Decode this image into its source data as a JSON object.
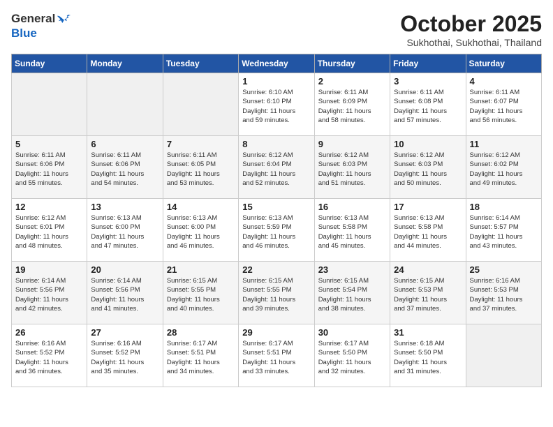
{
  "header": {
    "logo_general": "General",
    "logo_blue": "Blue",
    "month": "October 2025",
    "location": "Sukhothai, Sukhothai, Thailand"
  },
  "weekdays": [
    "Sunday",
    "Monday",
    "Tuesday",
    "Wednesday",
    "Thursday",
    "Friday",
    "Saturday"
  ],
  "weeks": [
    [
      {
        "day": "",
        "info": ""
      },
      {
        "day": "",
        "info": ""
      },
      {
        "day": "",
        "info": ""
      },
      {
        "day": "1",
        "info": "Sunrise: 6:10 AM\nSunset: 6:10 PM\nDaylight: 11 hours\nand 59 minutes."
      },
      {
        "day": "2",
        "info": "Sunrise: 6:11 AM\nSunset: 6:09 PM\nDaylight: 11 hours\nand 58 minutes."
      },
      {
        "day": "3",
        "info": "Sunrise: 6:11 AM\nSunset: 6:08 PM\nDaylight: 11 hours\nand 57 minutes."
      },
      {
        "day": "4",
        "info": "Sunrise: 6:11 AM\nSunset: 6:07 PM\nDaylight: 11 hours\nand 56 minutes."
      }
    ],
    [
      {
        "day": "5",
        "info": "Sunrise: 6:11 AM\nSunset: 6:06 PM\nDaylight: 11 hours\nand 55 minutes."
      },
      {
        "day": "6",
        "info": "Sunrise: 6:11 AM\nSunset: 6:06 PM\nDaylight: 11 hours\nand 54 minutes."
      },
      {
        "day": "7",
        "info": "Sunrise: 6:11 AM\nSunset: 6:05 PM\nDaylight: 11 hours\nand 53 minutes."
      },
      {
        "day": "8",
        "info": "Sunrise: 6:12 AM\nSunset: 6:04 PM\nDaylight: 11 hours\nand 52 minutes."
      },
      {
        "day": "9",
        "info": "Sunrise: 6:12 AM\nSunset: 6:03 PM\nDaylight: 11 hours\nand 51 minutes."
      },
      {
        "day": "10",
        "info": "Sunrise: 6:12 AM\nSunset: 6:03 PM\nDaylight: 11 hours\nand 50 minutes."
      },
      {
        "day": "11",
        "info": "Sunrise: 6:12 AM\nSunset: 6:02 PM\nDaylight: 11 hours\nand 49 minutes."
      }
    ],
    [
      {
        "day": "12",
        "info": "Sunrise: 6:12 AM\nSunset: 6:01 PM\nDaylight: 11 hours\nand 48 minutes."
      },
      {
        "day": "13",
        "info": "Sunrise: 6:13 AM\nSunset: 6:00 PM\nDaylight: 11 hours\nand 47 minutes."
      },
      {
        "day": "14",
        "info": "Sunrise: 6:13 AM\nSunset: 6:00 PM\nDaylight: 11 hours\nand 46 minutes."
      },
      {
        "day": "15",
        "info": "Sunrise: 6:13 AM\nSunset: 5:59 PM\nDaylight: 11 hours\nand 46 minutes."
      },
      {
        "day": "16",
        "info": "Sunrise: 6:13 AM\nSunset: 5:58 PM\nDaylight: 11 hours\nand 45 minutes."
      },
      {
        "day": "17",
        "info": "Sunrise: 6:13 AM\nSunset: 5:58 PM\nDaylight: 11 hours\nand 44 minutes."
      },
      {
        "day": "18",
        "info": "Sunrise: 6:14 AM\nSunset: 5:57 PM\nDaylight: 11 hours\nand 43 minutes."
      }
    ],
    [
      {
        "day": "19",
        "info": "Sunrise: 6:14 AM\nSunset: 5:56 PM\nDaylight: 11 hours\nand 42 minutes."
      },
      {
        "day": "20",
        "info": "Sunrise: 6:14 AM\nSunset: 5:56 PM\nDaylight: 11 hours\nand 41 minutes."
      },
      {
        "day": "21",
        "info": "Sunrise: 6:15 AM\nSunset: 5:55 PM\nDaylight: 11 hours\nand 40 minutes."
      },
      {
        "day": "22",
        "info": "Sunrise: 6:15 AM\nSunset: 5:55 PM\nDaylight: 11 hours\nand 39 minutes."
      },
      {
        "day": "23",
        "info": "Sunrise: 6:15 AM\nSunset: 5:54 PM\nDaylight: 11 hours\nand 38 minutes."
      },
      {
        "day": "24",
        "info": "Sunrise: 6:15 AM\nSunset: 5:53 PM\nDaylight: 11 hours\nand 37 minutes."
      },
      {
        "day": "25",
        "info": "Sunrise: 6:16 AM\nSunset: 5:53 PM\nDaylight: 11 hours\nand 37 minutes."
      }
    ],
    [
      {
        "day": "26",
        "info": "Sunrise: 6:16 AM\nSunset: 5:52 PM\nDaylight: 11 hours\nand 36 minutes."
      },
      {
        "day": "27",
        "info": "Sunrise: 6:16 AM\nSunset: 5:52 PM\nDaylight: 11 hours\nand 35 minutes."
      },
      {
        "day": "28",
        "info": "Sunrise: 6:17 AM\nSunset: 5:51 PM\nDaylight: 11 hours\nand 34 minutes."
      },
      {
        "day": "29",
        "info": "Sunrise: 6:17 AM\nSunset: 5:51 PM\nDaylight: 11 hours\nand 33 minutes."
      },
      {
        "day": "30",
        "info": "Sunrise: 6:17 AM\nSunset: 5:50 PM\nDaylight: 11 hours\nand 32 minutes."
      },
      {
        "day": "31",
        "info": "Sunrise: 6:18 AM\nSunset: 5:50 PM\nDaylight: 11 hours\nand 31 minutes."
      },
      {
        "day": "",
        "info": ""
      }
    ]
  ]
}
